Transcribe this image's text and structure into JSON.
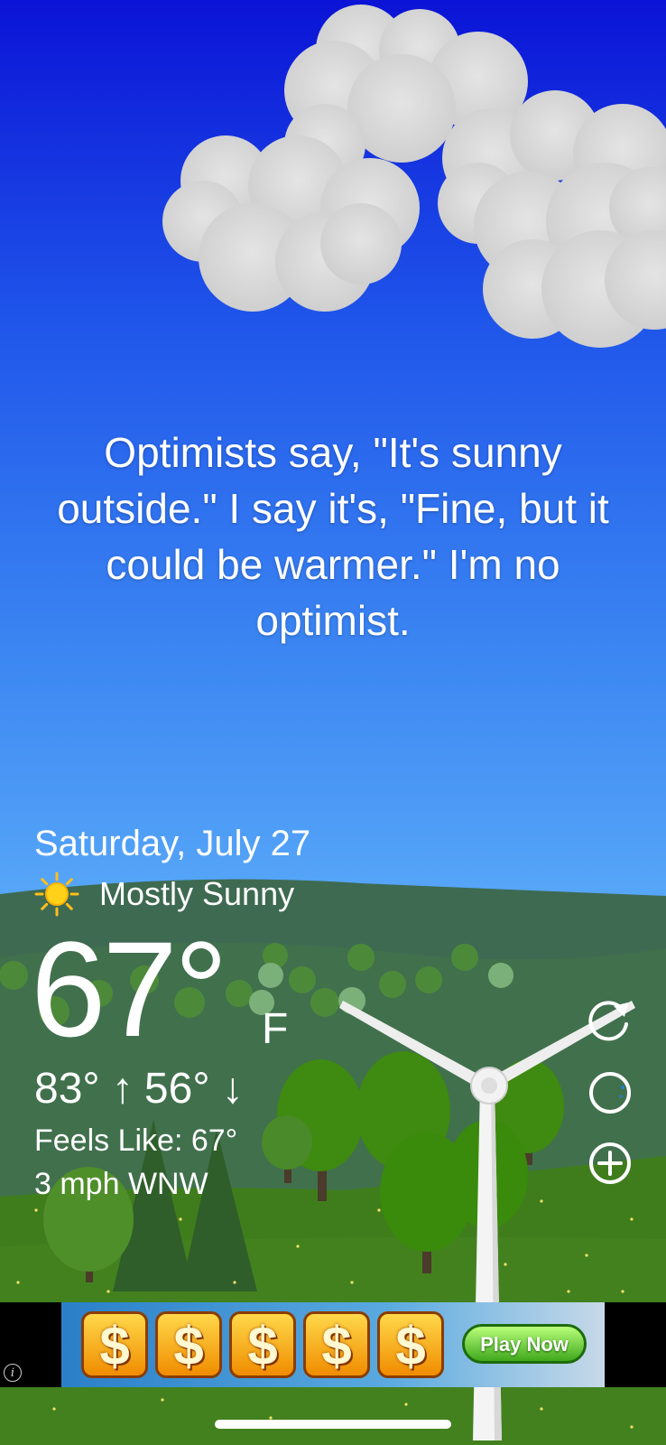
{
  "quote": "Optimists say, \"It's sunny outside.\" I say it's, \"Fine, but it could be warmer.\" I'm no optimist.",
  "weather": {
    "date": "Saturday, July 27",
    "condition_icon": "sun-icon",
    "condition": "Mostly Sunny",
    "temperature": "67°",
    "unit": "F",
    "high": "83° ↑",
    "low": "56° ↓",
    "feels_like": "Feels Like: 67°",
    "wind": "3 mph WNW"
  },
  "actions": [
    {
      "name": "refresh-icon"
    },
    {
      "name": "moon-icon"
    },
    {
      "name": "add-icon"
    }
  ],
  "ad": {
    "coin_symbol": "$",
    "coin_count": 5,
    "cta": "Play Now",
    "info_icon": "info-icon"
  },
  "colors": {
    "sky_top": "#0b13d6",
    "sky_bottom": "#62b0fa",
    "grass": "#3f7d1c",
    "sun": "#ffd21a"
  }
}
